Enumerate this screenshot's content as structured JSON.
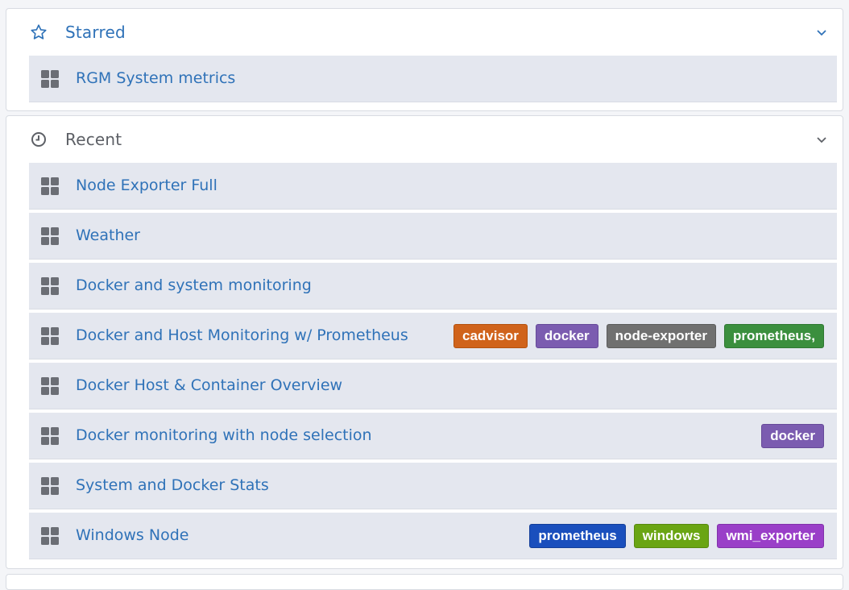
{
  "colors": {
    "link": "#2f72b8",
    "recent_title": "#5d6066",
    "tag_cadvisor": "#d0631b",
    "tag_docker": "#7b5cb0",
    "tag_node_exporter": "#707070",
    "tag_prometheus_comma": "#3b8f3e",
    "tag_prometheus": "#1a4fbd",
    "tag_windows": "#6aa513",
    "tag_wmi_exporter": "#9a3fc8"
  },
  "starred": {
    "title": "Starred",
    "items": [
      {
        "label": "RGM System metrics",
        "tags": []
      }
    ]
  },
  "recent": {
    "title": "Recent",
    "items": [
      {
        "label": "Node Exporter Full",
        "tags": []
      },
      {
        "label": "Weather",
        "tags": []
      },
      {
        "label": "Docker and system monitoring",
        "tags": []
      },
      {
        "label": "Docker and Host Monitoring w/ Prometheus",
        "tags": [
          "cadvisor",
          "docker",
          "node-exporter",
          "prometheus,"
        ]
      },
      {
        "label": "Docker Host & Container Overview",
        "tags": []
      },
      {
        "label": "Docker monitoring with node selection",
        "tags": [
          "docker"
        ]
      },
      {
        "label": "System and Docker Stats",
        "tags": []
      },
      {
        "label": "Windows Node",
        "tags": [
          "prometheus",
          "windows",
          "wmi_exporter"
        ]
      }
    ]
  }
}
